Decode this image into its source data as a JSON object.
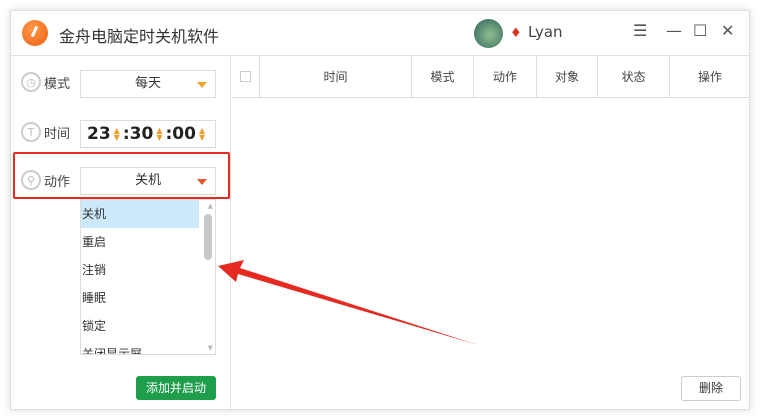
{
  "app": {
    "title": "金舟电脑定时关机软件",
    "user": "Lyan"
  },
  "left": {
    "mode_label": "模式",
    "mode_value": "每天",
    "time_label": "时间",
    "hour": "23",
    "minute": "30",
    "second": "00",
    "sep": ":",
    "action_label": "动作",
    "action_value": "关机",
    "action_options": [
      "关机",
      "重启",
      "注销",
      "睡眠",
      "锁定",
      "关闭显示屏"
    ],
    "add_button": "添加并启动"
  },
  "table": {
    "columns": [
      "时间",
      "模式",
      "动作",
      "对象",
      "状态",
      "操作"
    ]
  },
  "delete_button": "删除",
  "colors": {
    "accent": "#1e9e4a",
    "highlight": "#e52a22",
    "caret": "#f0a030"
  }
}
